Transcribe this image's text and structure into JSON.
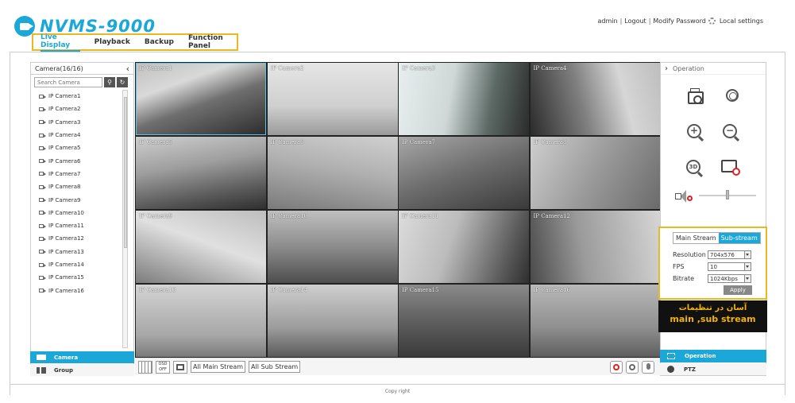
{
  "header": {
    "logo_text": "NVMS-9000",
    "links": [
      "admin",
      "Logout",
      "Modify Password",
      "Local settings"
    ]
  },
  "nav": {
    "tabs": [
      {
        "label": "Live Display",
        "active": true
      },
      {
        "label": "Playback",
        "active": false
      },
      {
        "label": "Backup",
        "active": false
      },
      {
        "label": "Function Panel",
        "active": false
      }
    ]
  },
  "left_panel": {
    "title": "Camera(16/16)",
    "search_placeholder": "Search Camera",
    "cameras": [
      "IP Camera1",
      "IP Camera2",
      "IP Camera3",
      "IP Camera4",
      "IP Camera5",
      "IP Camera6",
      "IP Camera7",
      "IP Camera8",
      "IP Camera9",
      "IP Camera10",
      "IP Camera11",
      "IP Camera12",
      "IP Camera13",
      "IP Camera14",
      "IP Camera15",
      "IP Camera16"
    ],
    "tab_camera": "Camera",
    "tab_group": "Group"
  },
  "grid": {
    "cells": [
      {
        "label": "IP Camera1",
        "selected": true
      },
      {
        "label": "IP Camera2",
        "selected": false
      },
      {
        "label": "IP Camera3",
        "selected": false
      },
      {
        "label": "IP Camera4",
        "selected": false
      },
      {
        "label": "IP Camera5",
        "selected": false
      },
      {
        "label": "IP Camera6",
        "selected": false
      },
      {
        "label": "IP Camera7",
        "selected": false
      },
      {
        "label": "IP Camera8",
        "selected": false
      },
      {
        "label": "IP Camera9",
        "selected": false
      },
      {
        "label": "IP Camera10",
        "selected": false
      },
      {
        "label": "IP Camera11",
        "selected": false
      },
      {
        "label": "IP Camera12",
        "selected": false
      },
      {
        "label": "IP Camera13",
        "selected": false
      },
      {
        "label": "IP Camera14",
        "selected": false
      },
      {
        "label": "IP Camera15",
        "selected": false
      },
      {
        "label": "IP Camera16",
        "selected": false
      }
    ]
  },
  "toolbar": {
    "osd_label": "OSD OFF",
    "all_main_stream": "All Main Stream",
    "all_sub_stream": "All Sub Stream"
  },
  "right_panel": {
    "title": "Operation",
    "stream": {
      "tab_main": "Main Stream",
      "tab_sub": "Sub-stream",
      "resolution_label": "Resolution",
      "resolution_value": "704x576",
      "fps_label": "FPS",
      "fps_value": "10",
      "bitrate_label": "Bitrate",
      "bitrate_value": "1024Kbps",
      "apply_label": "Apply"
    },
    "banner_line1": "آسان در تنظیمات",
    "banner_line2": "main ,sub stream",
    "tab_operation": "Operation",
    "tab_ptz": "PTZ"
  },
  "footer": {
    "copyright": "Copy right"
  },
  "colors": {
    "accent": "#1ba7d8",
    "highlight": "#e8b923",
    "banner_text": "#f5b400"
  }
}
